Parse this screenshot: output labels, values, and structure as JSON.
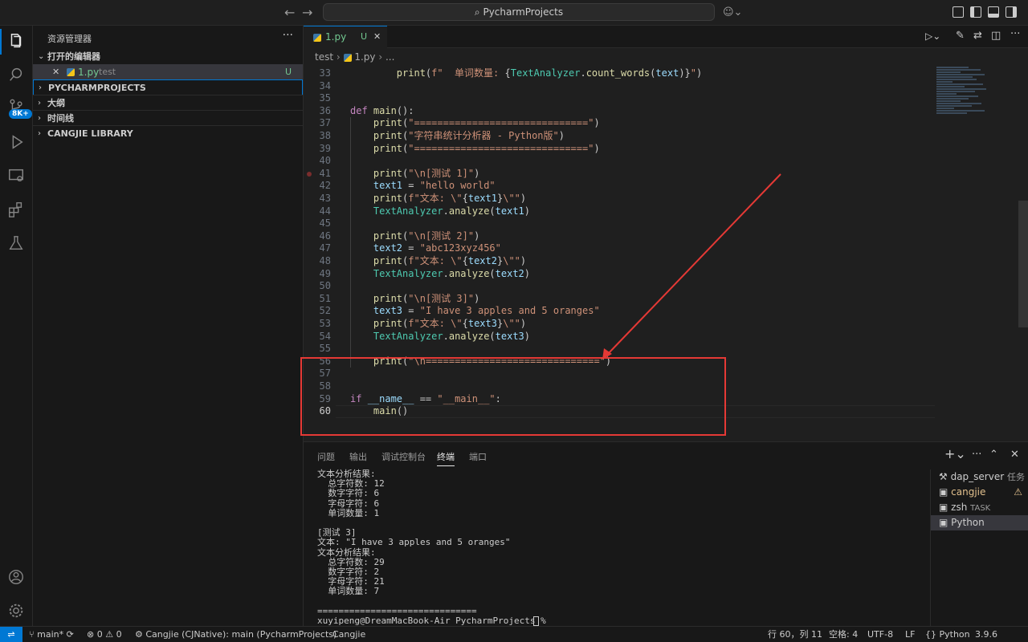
{
  "titlebar": {
    "search_text": "PycharmProjects"
  },
  "activity": {
    "badge": "8K+"
  },
  "sidebar": {
    "title": "资源管理器",
    "more": "···",
    "open_editors_label": "打开的编辑器",
    "open_editor_file": "1.py",
    "open_editor_dir": "test",
    "open_editor_status": "U",
    "sections": [
      "PYCHARMPROJECTS",
      "大纲",
      "时间线",
      "CANGJIE LIBRARY"
    ]
  },
  "editor": {
    "tab_name": "1.py",
    "tab_status": "U",
    "breadcrumb": [
      "test",
      "1.py",
      "..."
    ],
    "lines": [
      {
        "n": "33",
        "html": "        <span class='fn'>print</span>(<span class='st'>f\"  单词数量: </span>{<span class='cl'>TextAnalyzer</span>.<span class='fn'>count_words</span>(<span class='vr'>text</span>)}<span class='st'>\"</span>)"
      },
      {
        "n": "34",
        "html": ""
      },
      {
        "n": "35",
        "html": ""
      },
      {
        "n": "36",
        "html": "<span class='kw'>def</span> <span class='fn'>main</span>():"
      },
      {
        "n": "37",
        "html": "    <span class='fn'>print</span>(<span class='st'>\"==============================\"</span>)"
      },
      {
        "n": "38",
        "html": "    <span class='fn'>print</span>(<span class='st'>\"字符串统计分析器 - Python版\"</span>)"
      },
      {
        "n": "39",
        "html": "    <span class='fn'>print</span>(<span class='st'>\"==============================\"</span>)"
      },
      {
        "n": "40",
        "html": ""
      },
      {
        "n": "41",
        "html": "    <span class='fn'>print</span>(<span class='st'>\"\\n[测试 1]\"</span>)"
      },
      {
        "n": "42",
        "html": "    <span class='vr'>text1</span> = <span class='st'>\"hello world\"</span>"
      },
      {
        "n": "43",
        "html": "    <span class='fn'>print</span>(<span class='st'>f\"文本: \\\"</span>{<span class='vr'>text1</span>}<span class='st'>\\\"\"</span>)"
      },
      {
        "n": "44",
        "html": "    <span class='cl'>TextAnalyzer</span>.<span class='fn'>analyze</span>(<span class='vr'>text1</span>)"
      },
      {
        "n": "45",
        "html": ""
      },
      {
        "n": "46",
        "html": "    <span class='fn'>print</span>(<span class='st'>\"\\n[测试 2]\"</span>)"
      },
      {
        "n": "47",
        "html": "    <span class='vr'>text2</span> = <span class='st'>\"abc123xyz456\"</span>"
      },
      {
        "n": "48",
        "html": "    <span class='fn'>print</span>(<span class='st'>f\"文本: \\\"</span>{<span class='vr'>text2</span>}<span class='st'>\\\"\"</span>)"
      },
      {
        "n": "49",
        "html": "    <span class='cl'>TextAnalyzer</span>.<span class='fn'>analyze</span>(<span class='vr'>text2</span>)"
      },
      {
        "n": "50",
        "html": ""
      },
      {
        "n": "51",
        "html": "    <span class='fn'>print</span>(<span class='st'>\"\\n[测试 3]\"</span>)"
      },
      {
        "n": "52",
        "html": "    <span class='vr'>text3</span> = <span class='st'>\"I have 3 apples and 5 oranges\"</span>"
      },
      {
        "n": "53",
        "html": "    <span class='fn'>print</span>(<span class='st'>f\"文本: \\\"</span>{<span class='vr'>text3</span>}<span class='st'>\\\"\"</span>)"
      },
      {
        "n": "54",
        "html": "    <span class='cl'>TextAnalyzer</span>.<span class='fn'>analyze</span>(<span class='vr'>text3</span>)"
      },
      {
        "n": "55",
        "html": ""
      },
      {
        "n": "56",
        "html": "    <span class='fn'>print</span>(<span class='st'>\"\\n==============================\"</span>)"
      },
      {
        "n": "57",
        "html": ""
      },
      {
        "n": "58",
        "html": ""
      },
      {
        "n": "59",
        "html": "<span class='kw'>if</span> <span class='vr'>__name__</span> == <span class='st'>\"__main__\"</span>:"
      },
      {
        "n": "60",
        "html": "    <span class='fn'>main</span>()"
      }
    ]
  },
  "panel": {
    "tabs": [
      "问题",
      "输出",
      "调试控制台",
      "终端",
      "端口"
    ],
    "active_tab": "终端",
    "terminal_output": "文本分析结果:\n  总字符数: 12\n  数字字符: 6\n  字母字符: 6\n  单词数量: 1\n\n[测试 3]\n文本: \"I have 3 apples and 5 oranges\"\n文本分析结果:\n  总字符数: 29\n  数字字符: 2\n  字母字符: 21\n  单词数量: 7\n\n==============================\nxuyipeng@DreamMacBook-Air PycharmProjects % ",
    "terminals": [
      {
        "name": "dap_server",
        "extra": "任务",
        "color": "#cccccc"
      },
      {
        "name": "cangjie",
        "extra": "⚠",
        "color": "#e2c08d"
      },
      {
        "name": "zsh",
        "extra": "TASK",
        "color": "#cccccc"
      },
      {
        "name": "Python",
        "extra": "",
        "color": "#cccccc"
      }
    ]
  },
  "status": {
    "branch": "main*",
    "errors": "0",
    "warnings": "0",
    "debug_target": "Cangjie (CJNative): main (PycharmProjects)",
    "lang_ext": "Cangjie",
    "position": "行 60，列 11",
    "spaces": "空格: 4",
    "encoding": "UTF-8",
    "eol": "LF",
    "language": "Python",
    "python_version": "3.9.6"
  }
}
